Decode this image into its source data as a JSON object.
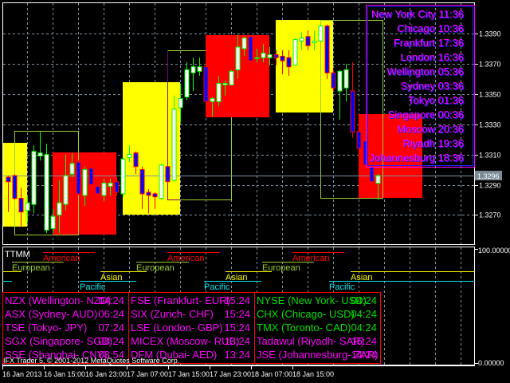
{
  "window": {
    "indicator_label": "TTMM",
    "copyright": "IFX Trader 5, © 2001-2012 MetaQuotes Software Corp."
  },
  "price_axis": {
    "ticks": [
      "1.3390",
      "1.3370",
      "1.3350",
      "1.3330",
      "1.3310",
      "1.3290",
      "1.3270"
    ],
    "current_price": "1.3296",
    "sub_top": "100.00000",
    "sub_bottom": "0.00000"
  },
  "time_axis": [
    "16 Jan 2013",
    "16 Jan 15:00",
    "16 Jan 23:00",
    "17 Jan 07:00",
    "17 Jan 15:00",
    "17 Jan 23:00",
    "18 Jan 07:00",
    "18 Jan 15:00"
  ],
  "world_clocks": [
    {
      "label": "New York City 11:36"
    },
    {
      "label": "Chicago 10:36"
    },
    {
      "label": "Frankfurt 17:36"
    },
    {
      "label": "London 16:36"
    },
    {
      "label": "Wellington 05:36"
    },
    {
      "label": "Sydney 03:36"
    },
    {
      "label": "Tokyo 01:36"
    },
    {
      "label": "Singapore 00:36"
    },
    {
      "label": "Moscow 20:36"
    },
    {
      "label": "Riyadh 19:36"
    },
    {
      "label": "Johannesburg 18:36"
    }
  ],
  "sessions": {
    "american": "American",
    "european": "European",
    "asian": "Asian",
    "pacific": "Pacific"
  },
  "exchanges": [
    [
      {
        "name": "NZX (Wellington- NZD)",
        "time": "04:24",
        "color": "#ff00ff"
      },
      {
        "name": "ASX (Sydney- AUD)",
        "time": "06:24",
        "color": "#ff00ff"
      },
      {
        "name": "TSE (Tokyo- JPY)",
        "time": "07:24",
        "color": "#ff00ff"
      },
      {
        "name": "SGX (Singapore- SGD)",
        "time": "08:24",
        "color": "#ff00ff"
      },
      {
        "name": "SSE (Shanghai- CNY)",
        "time": "08:54",
        "color": "#ff00ff"
      }
    ],
    [
      {
        "name": "FSE (Frankfurt- EUR)",
        "time": "15:24",
        "color": "#ff00ff"
      },
      {
        "name": "SIX (Zurich- CHF)",
        "time": "15:24",
        "color": "#ff00ff"
      },
      {
        "name": "LSE (London- GBP)",
        "time": "15:24",
        "color": "#ff00ff"
      },
      {
        "name": "MICEX (Moscow- RUB)",
        "time": "13:24",
        "color": "#ff00ff"
      },
      {
        "name": "DFM (Dubai- AED)",
        "time": "13:24",
        "color": "#ff00ff"
      }
    ],
    [
      {
        "name": "NYSE (New York- USD)",
        "time": "04:24",
        "color": "#00e000"
      },
      {
        "name": "CHX (Chicago- USD)",
        "time": "04:24",
        "color": "#00e000"
      },
      {
        "name": "TMX (Toronto- CAD)",
        "time": "04:24",
        "color": "#00e000"
      },
      {
        "name": "Tadawul (Riyadh- SAR)",
        "time": "15:24",
        "color": "#ff00ff"
      },
      {
        "name": "JSE (Johannesburg- ZAR)",
        "time": "14:24",
        "color": "#ff00ff"
      }
    ]
  ],
  "colors": {
    "bull_outline": "#00ff00",
    "bull_fill": "#ffffff",
    "bear_outline": "#ff0000",
    "bear_fill": "#0000ff",
    "asian_box": "#ffff00",
    "american_box": "#ff0000",
    "european_box": "#9acd32"
  },
  "chart_data": {
    "type": "candlestick",
    "ylim": [
      1.3262,
      1.341
    ],
    "candles": [
      [
        1.3295,
        1.3296,
        1.3272,
        1.3292
      ],
      [
        1.3296,
        1.3297,
        1.328,
        1.3281
      ],
      [
        1.3281,
        1.3288,
        1.3262,
        1.3272
      ],
      [
        1.3273,
        1.3282,
        1.3265,
        1.3278
      ],
      [
        1.3277,
        1.3316,
        1.3271,
        1.3312
      ],
      [
        1.3309,
        1.3325,
        1.3306,
        1.3311
      ],
      [
        1.326,
        1.3317,
        1.3258,
        1.331
      ],
      [
        1.3261,
        1.3274,
        1.3258,
        1.3269
      ],
      [
        1.327,
        1.3293,
        1.3258,
        1.3278
      ],
      [
        1.3277,
        1.331,
        1.3273,
        1.3296
      ],
      [
        1.3297,
        1.3311,
        1.3295,
        1.3304
      ],
      [
        1.3305,
        1.3306,
        1.3283,
        1.3284
      ],
      [
        1.3283,
        1.3302,
        1.3276,
        1.33
      ],
      [
        1.3301,
        1.3302,
        1.3288,
        1.329
      ],
      [
        1.3289,
        1.3291,
        1.3277,
        1.3284
      ],
      [
        1.3283,
        1.3294,
        1.3279,
        1.3291
      ],
      [
        1.3289,
        1.3294,
        1.3283,
        1.3291
      ],
      [
        1.3292,
        1.3295,
        1.3283,
        1.3285
      ],
      [
        1.3284,
        1.3308,
        1.3282,
        1.3307
      ],
      [
        1.3308,
        1.3316,
        1.3305,
        1.331
      ],
      [
        1.3311,
        1.3312,
        1.3297,
        1.3302
      ],
      [
        1.33,
        1.3302,
        1.3274,
        1.3284
      ],
      [
        1.3285,
        1.3287,
        1.3271,
        1.3283
      ],
      [
        1.3284,
        1.3285,
        1.3274,
        1.3282
      ],
      [
        1.3281,
        1.3304,
        1.328,
        1.3303
      ],
      [
        1.3302,
        1.3302,
        1.3291,
        1.3292
      ],
      [
        1.3293,
        1.3349,
        1.3292,
        1.334
      ],
      [
        1.3341,
        1.3357,
        1.3331,
        1.3347
      ],
      [
        1.3348,
        1.3371,
        1.3346,
        1.3366
      ],
      [
        1.3364,
        1.3374,
        1.3352,
        1.3368
      ],
      [
        1.3365,
        1.3374,
        1.3362,
        1.3368
      ],
      [
        1.3368,
        1.3369,
        1.3344,
        1.3345
      ],
      [
        1.3345,
        1.3348,
        1.3335,
        1.3347
      ],
      [
        1.3345,
        1.3362,
        1.3342,
        1.3357
      ],
      [
        1.3356,
        1.3359,
        1.3349,
        1.3357
      ],
      [
        1.3356,
        1.3366,
        1.3356,
        1.3365
      ],
      [
        1.3366,
        1.3389,
        1.336,
        1.3381
      ],
      [
        1.338,
        1.3388,
        1.3375,
        1.3387
      ],
      [
        1.3388,
        1.3388,
        1.3371,
        1.3372
      ],
      [
        1.3374,
        1.338,
        1.3371,
        1.3374
      ],
      [
        1.3374,
        1.3383,
        1.3371,
        1.3377
      ],
      [
        1.3374,
        1.3381,
        1.3369,
        1.3376
      ],
      [
        1.3376,
        1.3379,
        1.3369,
        1.3374
      ],
      [
        1.3375,
        1.3379,
        1.3363,
        1.3372
      ],
      [
        1.3374,
        1.3379,
        1.3362,
        1.3368
      ],
      [
        1.3369,
        1.3387,
        1.3369,
        1.3386
      ],
      [
        1.3385,
        1.3391,
        1.3379,
        1.3387
      ],
      [
        1.3388,
        1.3392,
        1.3379,
        1.3382
      ],
      [
        1.3384,
        1.3392,
        1.3379,
        1.3385
      ],
      [
        1.3385,
        1.3396,
        1.3385,
        1.3395
      ],
      [
        1.3395,
        1.3396,
        1.336,
        1.3364
      ],
      [
        1.3364,
        1.3366,
        1.3352,
        1.3354
      ],
      [
        1.3352,
        1.3366,
        1.3333,
        1.3365
      ],
      [
        1.3354,
        1.337,
        1.3345,
        1.3366
      ],
      [
        1.3352,
        1.3371,
        1.3321,
        1.3325
      ],
      [
        1.3325,
        1.3326,
        1.3314,
        1.3314
      ],
      [
        1.3319,
        1.3325,
        1.33,
        1.3303
      ],
      [
        1.3302,
        1.3303,
        1.329,
        1.3292
      ],
      [
        1.3291,
        1.3297,
        1.328,
        1.3296
      ]
    ]
  }
}
